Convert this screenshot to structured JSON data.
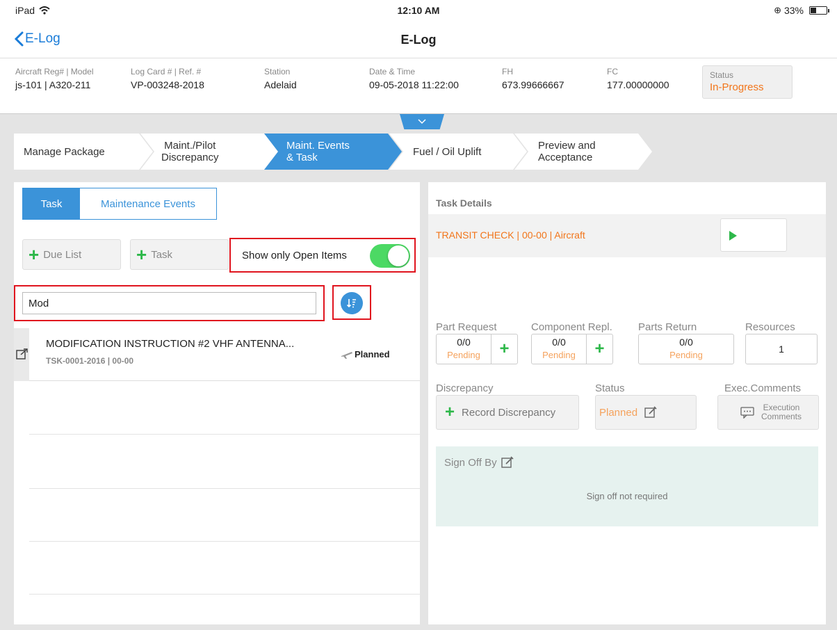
{
  "status_bar": {
    "device": "iPad",
    "time": "12:10 AM",
    "battery": "33%"
  },
  "nav": {
    "back_label": "E-Log",
    "title": "E-Log"
  },
  "info": {
    "aircraft": {
      "label": "Aircraft Reg# | Model",
      "value": "js-101 | A320-211"
    },
    "log_card": {
      "label": "Log Card # | Ref. #",
      "value": "VP-003248-2018"
    },
    "station": {
      "label": "Station",
      "value": "Adelaid"
    },
    "datetime": {
      "label": "Date & Time",
      "value": "09-05-2018 11:22:00"
    },
    "fh": {
      "label": "FH",
      "value": "673.99666667"
    },
    "fc": {
      "label": "FC",
      "value": "177.00000000"
    },
    "status": {
      "label": "Status",
      "value": "In-Progress"
    }
  },
  "steps": [
    {
      "label": "Manage Package",
      "active": false
    },
    {
      "label": "Maint./Pilot\nDiscrepancy",
      "line1": "Maint./Pilot",
      "line2": "Discrepancy",
      "active": false
    },
    {
      "label": "Maint. Events\n& Task",
      "line1": "Maint. Events",
      "line2": "& Task",
      "active": true
    },
    {
      "label": "Fuel / Oil Uplift",
      "active": false
    },
    {
      "label": "Preview and\nAcceptance",
      "line1": "Preview and",
      "line2": "Acceptance",
      "active": false
    }
  ],
  "left": {
    "tabs": {
      "task": "Task",
      "maintenance_events": "Maintenance Events"
    },
    "due_list_button": "Due List",
    "task_button": "Task",
    "toggle_label": "Show only Open Items",
    "toggle_on": true,
    "search_value": "Mod",
    "list": [
      {
        "title": "MODIFICATION INSTRUCTION #2 VHF ANTENNA...",
        "subtitle": "TSK-0001-2016 | 00-00",
        "status": "Planned"
      }
    ]
  },
  "right": {
    "title": "Task Details",
    "task_name": "TRANSIT CHECK | 00-00 | Aircraft",
    "part_request": {
      "label": "Part Request",
      "count": "0/0",
      "state": "Pending"
    },
    "component_repl": {
      "label": "Component Repl.",
      "count": "0/0",
      "state": "Pending"
    },
    "parts_return": {
      "label": "Parts Return",
      "count": "0/0",
      "state": "Pending"
    },
    "resources": {
      "label": "Resources",
      "count": "1"
    },
    "discrepancy": {
      "label": "Discrepancy",
      "button": "Record Discrepancy"
    },
    "status": {
      "label": "Status",
      "value": "Planned"
    },
    "exec_comments": {
      "label": "Exec.Comments",
      "line1": "Execution",
      "line2": "Comments"
    },
    "sign_off": {
      "label": "Sign Off By",
      "message": "Sign off not required"
    }
  },
  "colors": {
    "accent": "#3b93d9",
    "orange": "#f2751a",
    "green": "#2eb84a",
    "toggle": "#4cd964",
    "highlight": "#e0141e"
  }
}
